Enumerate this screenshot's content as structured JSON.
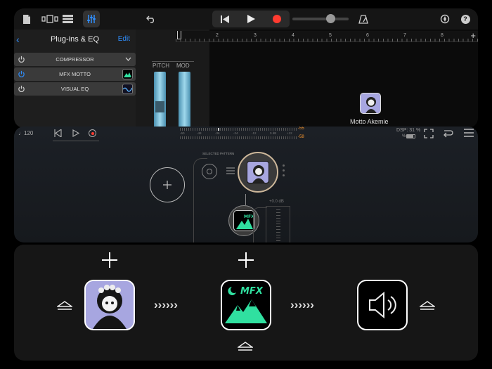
{
  "toolbar": {
    "icons": [
      "document-icon",
      "track-view-icon",
      "list-view-icon",
      "mixer-icon",
      "undo-icon",
      "rewind-icon",
      "play-icon",
      "record-icon",
      "metronome-icon",
      "settings-icon",
      "help-icon"
    ],
    "help_label": "?"
  },
  "plugins_panel": {
    "title": "Plug-ins & EQ",
    "edit_label": "Edit",
    "items": [
      {
        "label": "COMPRESSOR"
      },
      {
        "label": "MFX MOTTO"
      },
      {
        "label": "VISUAL EQ"
      }
    ]
  },
  "controls": {
    "pitch_label": "PITCH",
    "mod_label": "MOD"
  },
  "ruler": {
    "marks": [
      "2",
      "3",
      "4",
      "5",
      "6",
      "7",
      "8"
    ]
  },
  "track_instrument": {
    "name": "Motto Akemie"
  },
  "plugin_ui": {
    "tempo": "120",
    "meter_top": "-55",
    "meter_bottom": "-58",
    "meter_scale": [
      "-60",
      "-48",
      "-36",
      "-24",
      "-12",
      "0 dB",
      "+12"
    ],
    "dsp": "DSP: 31 %",
    "battery": "%",
    "selected_pattern_label": "SELECTED PATTERN",
    "gain_label": "+0.0 dB"
  },
  "chain": {
    "slots": [
      "motto-akemie-instrument",
      "mfx-effect",
      "speaker-output"
    ]
  },
  "colors": {
    "record": "#ff3b30",
    "accent_blue": "#2f8fff",
    "lavender": "#a7a6e0",
    "mint": "#30e0a0",
    "meter_orange": "#ff9a2e"
  }
}
